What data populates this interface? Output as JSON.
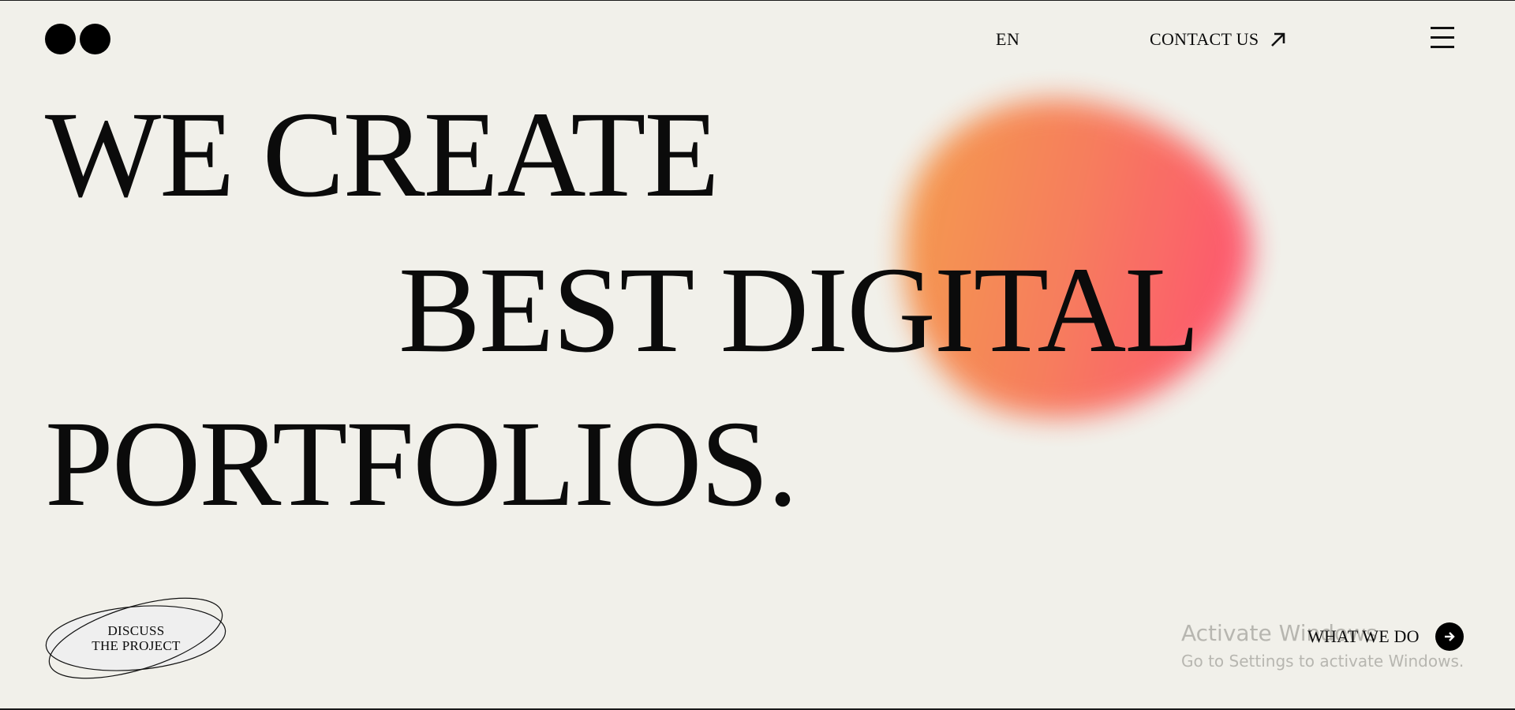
{
  "nav": {
    "language": "EN",
    "contact_label": "CONTACT US"
  },
  "hero": {
    "line1": "WE CREATE",
    "line2": "BEST DIGITAL",
    "line3": "PORTFOLIOS."
  },
  "cta": {
    "discuss_line1": "DISCUSS",
    "discuss_line2": "THE PROJECT",
    "what_we_do": "WHAT WE DO"
  },
  "watermark": {
    "title": "Activate Windows",
    "subtitle": "Go to Settings to activate Windows."
  },
  "colors": {
    "background": "#f1f0ea",
    "text": "#0b0b0b",
    "blob_start": "#f59447",
    "blob_end": "#fe4f69"
  },
  "icons": {
    "logo": "two-dots-logo",
    "contact": "arrow-up-right-icon",
    "menu": "hamburger-menu-icon",
    "what_we_do": "arrow-right-circle-icon"
  }
}
